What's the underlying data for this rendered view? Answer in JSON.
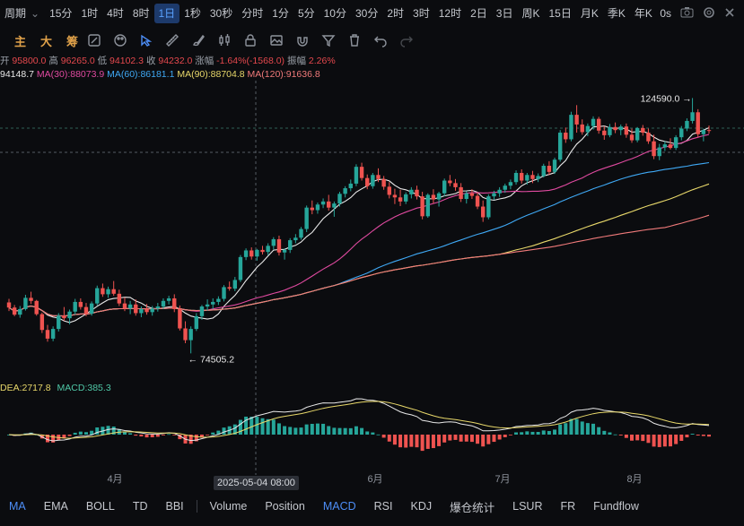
{
  "timeframes": [
    "周期",
    "15分",
    "1时",
    "4时",
    "8时",
    "1日",
    "1秒",
    "30秒",
    "分时",
    "1分",
    "5分",
    "10分",
    "30分",
    "2时",
    "3时",
    "12时",
    "2日",
    "3日",
    "周K",
    "15日",
    "月K",
    "季K",
    "年K"
  ],
  "active_timeframe": "1日",
  "topbar_right": {
    "countdown": "0s"
  },
  "toolbar": {
    "chips": [
      "主",
      "大",
      "筹"
    ]
  },
  "ohlc": {
    "open_label": "开",
    "open": "95800.0",
    "high_label": "高",
    "high": "96265.0",
    "low_label": "低",
    "low": "94102.3",
    "close_label": "收",
    "close": "94232.0",
    "change_label": "涨幅",
    "change": "-1.64%(-1568.0)",
    "amp_label": "振幅",
    "amp": "2.26%"
  },
  "ma_info": [
    {
      "text": "94148.7",
      "color": "#e9e9e9"
    },
    {
      "text": "MA(30):88073.9",
      "color": "#e04aa0"
    },
    {
      "text": "MA(60):86181.1",
      "color": "#3fa9f5"
    },
    {
      "text": "MA(90):88704.8",
      "color": "#e8d86a"
    },
    {
      "text": "MA(120):91636.8",
      "color": "#f07a7a"
    }
  ],
  "macd_info": [
    {
      "text": "DEA:2717.8",
      "color": "#e8d86a"
    },
    {
      "text": "MACD:385.3",
      "color": "#4fc7a6"
    }
  ],
  "annotations": {
    "high_price": "124590.0",
    "low_price": "74505.2"
  },
  "xaxis": {
    "labels": [
      "4月",
      "6月",
      "7月",
      "8月"
    ]
  },
  "cursor_date": "2025-05-04 08:00",
  "indicators": [
    "MA",
    "EMA",
    "BOLL",
    "TD",
    "BBI",
    "Volume",
    "Position",
    "MACD",
    "RSI",
    "KDJ",
    "爆仓统计",
    "LSUR",
    "FR",
    "Fundflow"
  ],
  "active_indicators": [
    "MA",
    "MACD"
  ],
  "colors": {
    "up": "#26a69a",
    "down": "#ef5350",
    "accent": "#4d8ef7",
    "bg": "#0b0c0f"
  },
  "chart_data": {
    "type": "candlestick",
    "price_range": [
      70000,
      128000
    ],
    "price_candles": [
      [
        84500,
        85200,
        82800,
        83500
      ],
      [
        83500,
        84000,
        81800,
        82100
      ],
      [
        82100,
        83800,
        81500,
        83200
      ],
      [
        83200,
        86000,
        82900,
        85400
      ],
      [
        85400,
        86600,
        84200,
        84800
      ],
      [
        84800,
        85000,
        81900,
        82200
      ],
      [
        82200,
        82500,
        78500,
        79100
      ],
      [
        79100,
        80100,
        76800,
        77400
      ],
      [
        77400,
        79800,
        76900,
        79300
      ],
      [
        79300,
        82400,
        78800,
        81900
      ],
      [
        81900,
        83600,
        80900,
        81400
      ],
      [
        81400,
        83100,
        80200,
        82700
      ],
      [
        82700,
        85200,
        82100,
        84600
      ],
      [
        84600,
        85300,
        83100,
        83600
      ],
      [
        83600,
        84400,
        81800,
        82300
      ],
      [
        82300,
        84700,
        81900,
        84300
      ],
      [
        84300,
        87800,
        83900,
        87300
      ],
      [
        87300,
        88200,
        85600,
        86100
      ],
      [
        86100,
        87600,
        85400,
        87100
      ],
      [
        87100,
        88700,
        85800,
        86200
      ],
      [
        86200,
        87000,
        83800,
        84300
      ],
      [
        84300,
        85500,
        82800,
        83300
      ],
      [
        83300,
        84800,
        82200,
        84100
      ],
      [
        84100,
        85100,
        81900,
        82400
      ],
      [
        82400,
        83700,
        81600,
        83200
      ],
      [
        83200,
        84200,
        82100,
        82600
      ],
      [
        82600,
        83800,
        81900,
        83300
      ],
      [
        83300,
        84400,
        82700,
        83700
      ],
      [
        83700,
        85300,
        83200,
        84800
      ],
      [
        84800,
        85800,
        84100,
        85300
      ],
      [
        85300,
        86100,
        82600,
        83200
      ],
      [
        83200,
        83900,
        79000,
        79400
      ],
      [
        79400,
        80800,
        76500,
        77100
      ],
      [
        77100,
        79800,
        74505,
        79300
      ],
      [
        79300,
        82400,
        78900,
        81800
      ],
      [
        81800,
        84000,
        81100,
        83700
      ],
      [
        83700,
        85100,
        82900,
        84100
      ],
      [
        84100,
        85300,
        83200,
        84600
      ],
      [
        84600,
        85700,
        84000,
        85200
      ],
      [
        85200,
        87900,
        84700,
        87500
      ],
      [
        87500,
        88600,
        86800,
        87200
      ],
      [
        87200,
        89500,
        86700,
        88900
      ],
      [
        88900,
        93800,
        88500,
        93400
      ],
      [
        93400,
        95100,
        92800,
        94700
      ],
      [
        94700,
        95300,
        92900,
        93500
      ],
      [
        93500,
        95000,
        92700,
        94800
      ],
      [
        94800,
        95600,
        93900,
        94400
      ],
      [
        94400,
        96100,
        93800,
        95600
      ],
      [
        95600,
        97300,
        94900,
        96900
      ],
      [
        96900,
        97600,
        93700,
        94300
      ],
      [
        94300,
        95100,
        92900,
        94800
      ],
      [
        94800,
        97100,
        94200,
        96700
      ],
      [
        96700,
        97900,
        96100,
        97200
      ],
      [
        97200,
        99300,
        96800,
        98900
      ],
      [
        98900,
        103500,
        98300,
        103100
      ],
      [
        103100,
        104500,
        101800,
        102600
      ],
      [
        102600,
        104100,
        101900,
        103700
      ],
      [
        103700,
        104900,
        103000,
        104300
      ],
      [
        104300,
        105600,
        102500,
        103100
      ],
      [
        103100,
        104300,
        101300,
        103900
      ],
      [
        103900,
        106200,
        103300,
        105800
      ],
      [
        105800,
        107300,
        105100,
        106900
      ],
      [
        106900,
        108600,
        106300,
        107800
      ],
      [
        107800,
        111600,
        107300,
        111100
      ],
      [
        111100,
        111900,
        108400,
        108900
      ],
      [
        108900,
        109600,
        106700,
        107300
      ],
      [
        107300,
        109900,
        106800,
        109500
      ],
      [
        109500,
        110800,
        108100,
        108700
      ],
      [
        108700,
        109300,
        106600,
        107200
      ],
      [
        107200,
        108100,
        104900,
        105600
      ],
      [
        105600,
        106800,
        103800,
        105100
      ],
      [
        105100,
        106600,
        103400,
        104300
      ],
      [
        104300,
        106100,
        103800,
        105700
      ],
      [
        105700,
        107100,
        104900,
        106600
      ],
      [
        106600,
        107400,
        104700,
        105300
      ],
      [
        105300,
        106200,
        100800,
        101400
      ],
      [
        101400,
        105900,
        101100,
        105600
      ],
      [
        105600,
        106700,
        103900,
        104700
      ],
      [
        104700,
        106200,
        103300,
        105900
      ],
      [
        105900,
        108800,
        105300,
        108400
      ],
      [
        108400,
        109500,
        107300,
        107900
      ],
      [
        107900,
        108700,
        106400,
        107100
      ],
      [
        107100,
        107900,
        104200,
        104800
      ],
      [
        104800,
        106300,
        103900,
        105900
      ],
      [
        105900,
        106700,
        104800,
        105400
      ],
      [
        105400,
        106100,
        102800,
        103300
      ],
      [
        103300,
        104500,
        100300,
        101200
      ],
      [
        101200,
        105700,
        100800,
        105300
      ],
      [
        105300,
        106400,
        104600,
        105900
      ],
      [
        105900,
        107100,
        105200,
        106600
      ],
      [
        106600,
        107800,
        106000,
        107400
      ],
      [
        107400,
        108600,
        106700,
        108100
      ],
      [
        108100,
        110400,
        107600,
        109900
      ],
      [
        109900,
        110600,
        107800,
        108400
      ],
      [
        108400,
        109900,
        107600,
        109500
      ],
      [
        109500,
        110300,
        107900,
        108700
      ],
      [
        108700,
        109800,
        108100,
        109300
      ],
      [
        109300,
        111700,
        109000,
        111300
      ],
      [
        111300,
        112200,
        109500,
        110100
      ],
      [
        110100,
        112900,
        109700,
        112500
      ],
      [
        112500,
        118300,
        112100,
        117800
      ],
      [
        117800,
        118800,
        115800,
        116500
      ],
      [
        116500,
        121900,
        116100,
        121300
      ],
      [
        121300,
        123200,
        117800,
        119400
      ],
      [
        119400,
        120400,
        117400,
        117900
      ],
      [
        117900,
        119600,
        117100,
        119100
      ],
      [
        119100,
        121000,
        118400,
        120500
      ],
      [
        120500,
        120900,
        117600,
        118200
      ],
      [
        118200,
        119100,
        116400,
        117300
      ],
      [
        117300,
        119500,
        116900,
        118900
      ],
      [
        118900,
        119800,
        117700,
        118300
      ],
      [
        118300,
        119400,
        117300,
        119000
      ],
      [
        119000,
        119600,
        116800,
        117400
      ],
      [
        117400,
        118600,
        115800,
        116300
      ],
      [
        116300,
        118900,
        115900,
        118700
      ],
      [
        118700,
        119300,
        117200,
        117800
      ],
      [
        117800,
        118600,
        115600,
        116100
      ],
      [
        116100,
        117400,
        112600,
        113200
      ],
      [
        113200,
        115600,
        112400,
        114900
      ],
      [
        114900,
        116100,
        114200,
        115500
      ],
      [
        115500,
        116700,
        114500,
        114800
      ],
      [
        114800,
        117300,
        114400,
        116900
      ],
      [
        116900,
        119100,
        116300,
        118600
      ],
      [
        118600,
        120600,
        118100,
        120100
      ],
      [
        120100,
        124590,
        119600,
        121800
      ],
      [
        121800,
        122400,
        116900,
        117500
      ],
      [
        117500,
        118600,
        116100,
        118300
      ],
      [
        118300,
        119200,
        117600,
        118200
      ]
    ],
    "series_colors": {
      "MA7": "#e9e9e9",
      "MA30": "#e04aa0",
      "MA60": "#3fa9f5",
      "MA90": "#e8d86a",
      "MA120": "#f07a7a",
      "DIF": "#e9e9e9",
      "DEA": "#e8d86a"
    }
  }
}
